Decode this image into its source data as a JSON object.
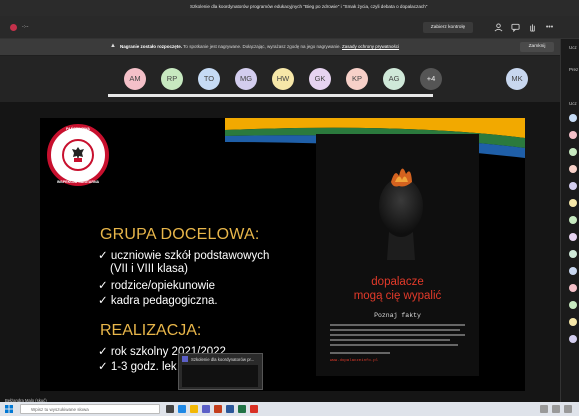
{
  "window": {
    "title": "Szkolenie dla koordynatorów programów edukacyjnych \"Bieg po zdrowie\" i \"Smak życia, czyli debata o dopalaczach\""
  },
  "topbar": {
    "recording_time": "-:--",
    "take_control_label": "Zabierz kontrolę",
    "icons": [
      "people-icon",
      "chat-icon",
      "hand-icon",
      "more-icon"
    ]
  },
  "notice": {
    "bold": "Nagranie zostało rozpoczęte.",
    "text": " To spotkanie jest nagrywane. Dołączając, wyrażasz zgodę na jego nagrywanie. ",
    "link": "Zasady ochrony prywatności",
    "dismiss_label": "Zamknij"
  },
  "participants": [
    {
      "initials": "AM",
      "color": "#f4c0c8"
    },
    {
      "initials": "RP",
      "color": "#c7e9c0"
    },
    {
      "initials": "TO",
      "color": "#c6dbf5"
    },
    {
      "initials": "MG",
      "color": "#d3cdee"
    },
    {
      "initials": "HW",
      "color": "#f6e7a8"
    },
    {
      "initials": "GK",
      "color": "#e6d3f0"
    },
    {
      "initials": "KP",
      "color": "#f7d0c8"
    },
    {
      "initials": "AG",
      "color": "#cfe8d8"
    },
    {
      "initials": "+4",
      "color": "#555555"
    },
    {
      "initials": "MK",
      "color": "#c8d7ef"
    }
  ],
  "slide": {
    "logo_top": "PAŃSTWOWA",
    "logo_bottom": "INSPEKCJA SANITARNA",
    "heading1": "GRUPA DOCELOWA:",
    "items1": [
      "✓ uczniowie szkół podstawowych",
      "(VII i VIII klasa)",
      "✓ rodzice/opiekunowie",
      "✓ kadra pedagogiczna."
    ],
    "heading2": "REALIZACJA:",
    "items2": [
      "✓ rok szkolny 2021/2022",
      "✓ 1-3 godz. lek"
    ],
    "poster": {
      "line1": "dopalacze",
      "line2": "mogą cię wypalić",
      "facts": "Poznaj fakty",
      "site": "www.dopalaczeinfo.pl"
    }
  },
  "thumbnail": {
    "title": "Szkolenie dla koordynatorów pr..."
  },
  "presenter": {
    "name": "Bełżandra Malo (skuć)"
  },
  "right_panel": {
    "header": "Ucz",
    "section": "Prez",
    "section2": "Ucz"
  },
  "taskbar": {
    "search_placeholder": "Wpisz tu wyszukiwane słowa"
  }
}
